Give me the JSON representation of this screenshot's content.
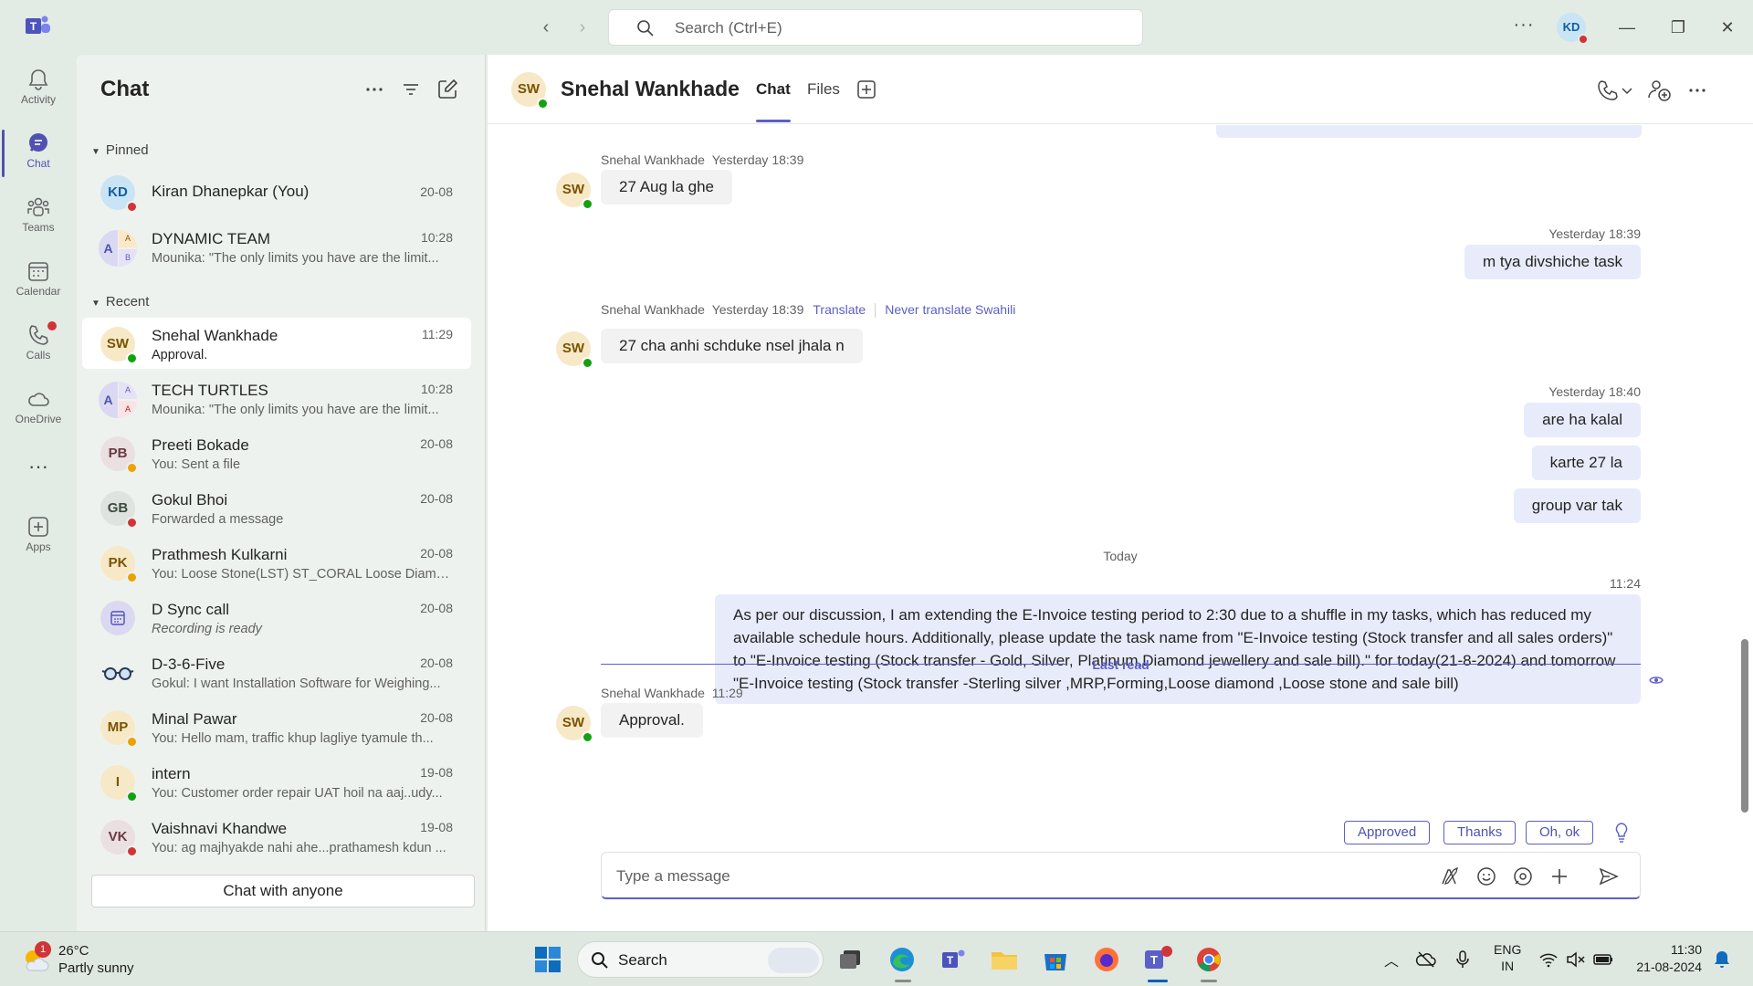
{
  "titlebar": {
    "search_placeholder": "Search (Ctrl+E)",
    "user_initials": "KD",
    "back_glyph": "‹",
    "forward_glyph": "›",
    "more_glyph": "···",
    "minimize_glyph": "—",
    "restore_glyph": "❐",
    "close_glyph": "✕"
  },
  "rail": {
    "items": [
      {
        "label": "Activity",
        "icon": "bell-icon"
      },
      {
        "label": "Chat",
        "icon": "chat-icon"
      },
      {
        "label": "Teams",
        "icon": "teams-icon"
      },
      {
        "label": "Calendar",
        "icon": "calendar-icon"
      },
      {
        "label": "Calls",
        "icon": "phone-icon"
      },
      {
        "label": "OneDrive",
        "icon": "cloud-icon"
      },
      {
        "label": "Apps",
        "icon": "add-apps-icon"
      }
    ],
    "more_glyph": "···"
  },
  "chat_list": {
    "title": "Chat",
    "pinned_label": "Pinned",
    "recent_label": "Recent",
    "pinned": [
      {
        "initials": "KD",
        "name": "Kiran Dhanepkar (You)",
        "time": "20-08",
        "preview": "",
        "status": "red"
      },
      {
        "initials": "A",
        "name": "DYNAMIC TEAM",
        "time": "10:28",
        "preview": "Mounika: \"The only limits you have are the limit...",
        "group": true,
        "g2": "A",
        "g3": "B"
      }
    ],
    "recent": [
      {
        "initials": "SW",
        "name": "Snehal Wankhade",
        "time": "11:29",
        "preview": "Approval.",
        "status": "green",
        "selected": true
      },
      {
        "initials": "A",
        "name": "TECH TURTLES",
        "time": "10:28",
        "preview": "Mounika: \"The only limits you have are the limit...",
        "group": true,
        "g2": "A",
        "g3": "A"
      },
      {
        "initials": "PB",
        "name": "Preeti Bokade",
        "time": "20-08",
        "preview": "You: Sent a file",
        "status": "yellow"
      },
      {
        "initials": "GB",
        "name": "Gokul Bhoi",
        "time": "20-08",
        "preview": "Forwarded a message",
        "status": "red"
      },
      {
        "initials": "PK",
        "name": "Prathmesh Kulkarni",
        "time": "20-08",
        "preview": "You: Loose Stone(LST) ST_CORAL Loose Diamo...",
        "status": "yellow"
      },
      {
        "initials": "",
        "name": "D Sync call",
        "time": "20-08",
        "preview": "Recording is ready",
        "meeting": true
      },
      {
        "initials": "",
        "name": "D-3-6-Five",
        "time": "20-08",
        "preview": "Gokul: I want Installation Software for Weighing...",
        "glasses": true
      },
      {
        "initials": "MP",
        "name": "Minal Pawar",
        "time": "20-08",
        "preview": "You: Hello mam, traffic khup lagliye tyamule th...",
        "status": "yellow"
      },
      {
        "initials": "I",
        "name": "intern",
        "time": "19-08",
        "preview": "You: Customer order repair UAT hoil na aaj..udy...",
        "status": "green"
      },
      {
        "initials": "VK",
        "name": "Vaishnavi Khandwe",
        "time": "19-08",
        "preview": "You: ag majhyakde nahi ahe...prathamesh kdun ...",
        "status": "red"
      }
    ],
    "chat_with_anyone": "Chat with anyone"
  },
  "conversation": {
    "contact_initials": "SW",
    "contact_name": "Snehal Wankhade",
    "tabs": [
      "Chat",
      "Files"
    ],
    "messages": [
      {
        "sender": "Snehal Wankhade",
        "time": "Yesterday 18:39",
        "text": "27 Aug la ghe"
      },
      {
        "time": "Yesterday 18:39",
        "text": "m tya divshiche task"
      },
      {
        "sender": "Snehal Wankhade",
        "time": "Yesterday 18:39",
        "translate": "Translate",
        "never_translate": "Never translate Swahili",
        "text": "27 cha anhi schduke nsel jhala n"
      },
      {
        "time": "Yesterday 18:40",
        "lines": [
          "are ha kalal",
          "karte 27 la",
          "group var tak"
        ]
      },
      {
        "day": "Today"
      },
      {
        "time": "11:24",
        "text": "As per our discussion, I am extending the E-Invoice testing period to 2:30 due to a shuffle in my tasks, which has reduced my available schedule hours. Additionally, please update the task name from \"E-Invoice testing (Stock transfer and all sales orders)\" to \"E-Invoice testing (Stock transfer - Gold, Silver, Platinum,Diamond jewellery and sale bill).\" for today(21-8-2024) and tomorrow \"E-Invoice testing (Stock transfer -Sterling silver ,MRP,Forming,Loose diamond ,Loose stone and sale bill)"
      },
      {
        "last_read": "Last read"
      },
      {
        "sender": "Snehal Wankhade",
        "time": "11:29",
        "text": "Approval."
      }
    ],
    "suggestions": [
      "Approved",
      "Thanks",
      "Oh, ok"
    ],
    "compose_placeholder": "Type a message"
  },
  "taskbar": {
    "weather_badge": "1",
    "temperature": "26°C",
    "condition": "Partly sunny",
    "search_label": "Search",
    "lang_top": "ENG",
    "lang_bottom": "IN",
    "time": "11:30",
    "date": "21-08-2024",
    "caret_glyph": "︿"
  },
  "colors": {
    "accent": "#5b5fc7",
    "status_available": "#13a10e",
    "status_busy": "#d13438",
    "status_away": "#eaa300"
  }
}
